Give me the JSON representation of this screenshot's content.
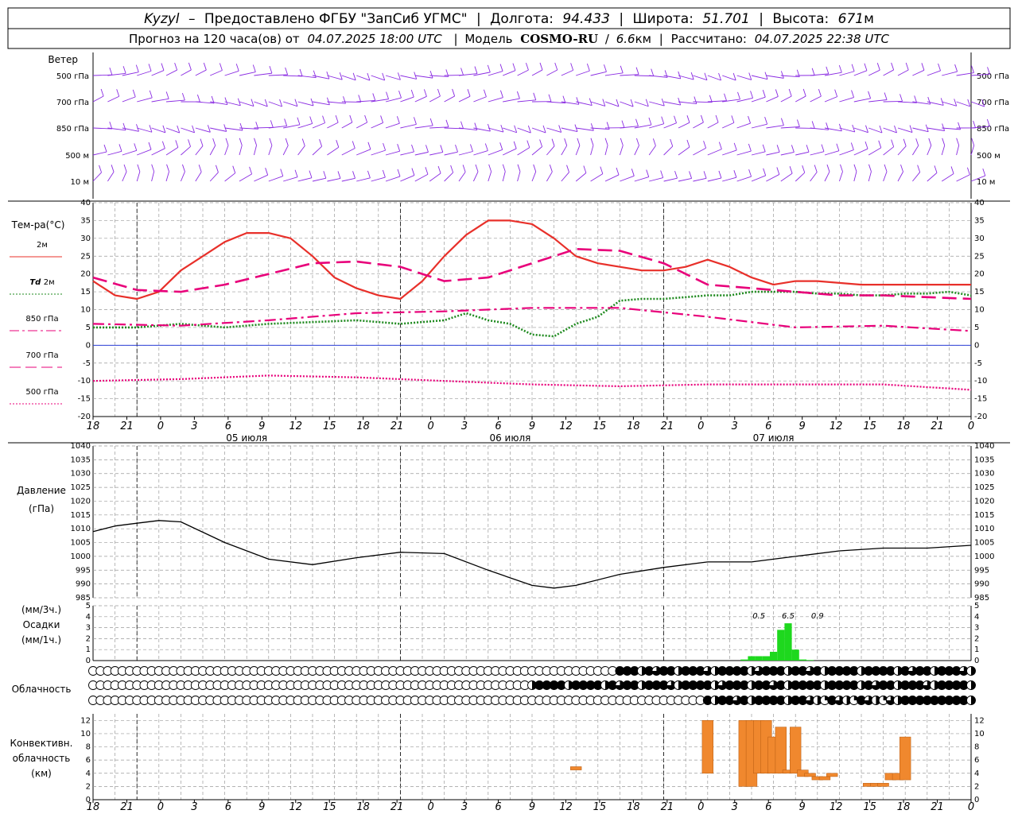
{
  "header": {
    "station": "Kyzyl",
    "dash": "–",
    "provider": "Предоставлено ФГБУ \"ЗапСиб УГМС\"",
    "lon_label": "Долгота:",
    "lon_value": "94.433",
    "lat_label": "Широта:",
    "lat_value": "51.701",
    "alt_label": "Высота:",
    "alt_value": "671",
    "alt_unit": "м",
    "sep": "|",
    "forecast_label": "Прогноз на 120 часа(ов) от",
    "forecast_from": "04.07.2025 18:00 UTC",
    "model_label": "Модель",
    "model_name": "COSMO-RU",
    "model_res": "6.6",
    "model_res_unit": "км",
    "calc_label": "Рассчитано:",
    "calc_time": "04.07.2025 22:38 UTC"
  },
  "wind_panel": {
    "title": "Ветер",
    "levels": [
      "500 гПа",
      "700 гПа",
      "850 гПа",
      "500 м",
      "10 м"
    ],
    "barb_color": "#8a2be2"
  },
  "temp_panel": {
    "title": "Тем-ра(°C)",
    "legend": [
      {
        "label": "2м",
        "color": "#e8302a",
        "style": "solid"
      },
      {
        "label_italic": "Td",
        "label": "2м",
        "color": "#1f8a1f",
        "style": "dotted"
      },
      {
        "label": "850 гПа",
        "color": "#e8007a",
        "style": "dash-dot"
      },
      {
        "label": "700 гПа",
        "color": "#e8007a",
        "style": "long-dash"
      },
      {
        "label": "500 гПа",
        "color": "#e8007a",
        "style": "dotted"
      }
    ],
    "yticks": [
      "40",
      "35",
      "30",
      "25",
      "20",
      "15",
      "10",
      "5",
      "0",
      "-5",
      "-10",
      "-15",
      "-20"
    ]
  },
  "time_axis": {
    "hour_labels": [
      "18",
      "21",
      "0",
      "3",
      "6",
      "9",
      "12",
      "15",
      "18",
      "21",
      "0",
      "3",
      "6",
      "9",
      "12",
      "15",
      "18",
      "21",
      "0",
      "3",
      "6",
      "9",
      "12",
      "15",
      "18",
      "21",
      "0"
    ],
    "day_labels": [
      "05 июля",
      "06 июля",
      "07 июля"
    ]
  },
  "pressure_panel": {
    "title_line1": "Давление",
    "title_line2": "(гПа)",
    "yticks": [
      "1040",
      "1035",
      "1030",
      "1025",
      "1020",
      "1015",
      "1010",
      "1005",
      "1000",
      "995",
      "990",
      "985"
    ]
  },
  "precip_panel": {
    "unit_top": "(мм/3ч.)",
    "title": "Осадки",
    "unit_bottom": "(мм/1ч.)",
    "yticks": [
      "5",
      "4",
      "3",
      "2",
      "1",
      "0"
    ],
    "totals": [
      "0.5",
      "6.5",
      "0.9"
    ],
    "bar_color": "#1ed81e"
  },
  "cloud_panel": {
    "title": "Облачность"
  },
  "conv_panel": {
    "title_line1": "Конвективн.",
    "title_line2": "облачность",
    "title_line3": "(км)",
    "yticks": [
      "12",
      "10",
      "8",
      "6",
      "4",
      "2",
      "0"
    ],
    "bar_color": "#f0882e"
  },
  "chart_data": [
    {
      "type": "line",
      "title": "Тем-ра(°C)",
      "x_unit": "hours since 04.07.2025 18:00 UTC",
      "ylim": [
        -20,
        40
      ],
      "series": [
        {
          "name": "2м",
          "x": [
            0,
            3,
            6,
            9,
            12,
            15,
            18,
            21,
            24,
            27,
            30,
            33,
            36,
            39,
            42,
            45,
            48,
            51,
            54,
            57,
            60,
            63,
            66,
            69,
            72,
            75,
            78,
            81,
            84,
            87,
            90,
            93,
            96,
            99,
            102,
            105,
            108,
            111,
            114,
            117,
            120
          ],
          "values": [
            18,
            14,
            13,
            15,
            21,
            25,
            29,
            31.5,
            31.5,
            30,
            25,
            19,
            16,
            14,
            13,
            18,
            25,
            31,
            35,
            35,
            34,
            30,
            25,
            23,
            22,
            21,
            21,
            22,
            24,
            22,
            19,
            17,
            18,
            18,
            17.5,
            17,
            17,
            17,
            17,
            17,
            17
          ]
        },
        {
          "name": "Td 2м",
          "x": [
            0,
            6,
            12,
            18,
            24,
            30,
            36,
            42,
            48,
            51,
            54,
            57,
            60,
            63,
            66,
            69,
            72,
            75,
            78,
            81,
            84,
            87,
            90,
            93,
            96,
            99,
            102,
            105,
            108,
            111,
            114,
            117,
            120
          ],
          "values": [
            5,
            5,
            6,
            5,
            6,
            6.5,
            7,
            6,
            7,
            9,
            7,
            6,
            3,
            2.5,
            6,
            8,
            12.5,
            13,
            13,
            13.5,
            14,
            14,
            15,
            15,
            15,
            14.5,
            14.5,
            14,
            14,
            14.5,
            14.5,
            15,
            14
          ]
        },
        {
          "name": "850 гПа",
          "x": [
            0,
            12,
            24,
            36,
            48,
            60,
            72,
            84,
            96,
            108,
            120
          ],
          "values": [
            6,
            5.5,
            7,
            9,
            9.5,
            10.5,
            10.5,
            8,
            5,
            5.5,
            4
          ]
        },
        {
          "name": "700 гПа",
          "x": [
            0,
            6,
            12,
            18,
            24,
            30,
            36,
            42,
            48,
            54,
            60,
            66,
            72,
            78,
            84,
            90,
            96,
            102,
            108,
            114,
            120
          ],
          "values": [
            19,
            15.5,
            15,
            17,
            20,
            23,
            23.5,
            22,
            18,
            19,
            23,
            27,
            26.5,
            23,
            17,
            16,
            15,
            14,
            14,
            13.5,
            13
          ]
        },
        {
          "name": "500 гПа",
          "x": [
            0,
            12,
            24,
            36,
            48,
            60,
            72,
            84,
            96,
            108,
            120
          ],
          "values": [
            -10,
            -9.5,
            -8.5,
            -9,
            -10,
            -11,
            -11.5,
            -11,
            -11,
            -11,
            -12.5
          ]
        }
      ]
    },
    {
      "type": "line",
      "title": "Давление (гПа)",
      "x_unit": "hours since 04.07.2025 18:00 UTC",
      "ylim": [
        985,
        1040
      ],
      "series": [
        {
          "name": "Давление",
          "x": [
            0,
            3,
            6,
            9,
            12,
            18,
            24,
            30,
            36,
            42,
            48,
            54,
            60,
            63,
            66,
            72,
            78,
            84,
            90,
            96,
            102,
            108,
            114,
            120
          ],
          "values": [
            1009,
            1011,
            1012,
            1013,
            1012.5,
            1005,
            999,
            997,
            999.5,
            1001.5,
            1001,
            995,
            989.5,
            988.5,
            989.5,
            993.5,
            996,
            998,
            998,
            1000,
            1002,
            1003,
            1003,
            1004
          ]
        }
      ]
    },
    {
      "type": "bar",
      "title": "Осадки (мм/1ч.)",
      "x_unit": "hours since 04.07.2025 18:00 UTC",
      "ylim": [
        0,
        5
      ],
      "x": [
        89,
        90,
        91,
        92,
        93,
        94,
        95,
        96,
        97,
        98
      ],
      "values": [
        0.1,
        0.4,
        0.4,
        0.4,
        0.8,
        2.8,
        3.4,
        1.0,
        0.1,
        0.05
      ]
    },
    {
      "type": "bar",
      "title": "Конвективн. облачность (км)",
      "x_unit": "hours since 04.07.2025 18:00 UTC",
      "ylim": [
        0,
        12
      ],
      "bars": [
        {
          "x": 66,
          "bottom": 4.5,
          "top": 5
        },
        {
          "x": 84,
          "bottom": 4,
          "top": 12
        },
        {
          "x": 89,
          "bottom": 2,
          "top": 12
        },
        {
          "x": 90,
          "bottom": 2,
          "top": 12
        },
        {
          "x": 91,
          "bottom": 4,
          "top": 12
        },
        {
          "x": 92,
          "bottom": 4,
          "top": 12
        },
        {
          "x": 93,
          "bottom": 4,
          "top": 9.5
        },
        {
          "x": 94,
          "bottom": 4,
          "top": 11
        },
        {
          "x": 95,
          "bottom": 4,
          "top": 4.5
        },
        {
          "x": 96,
          "bottom": 4,
          "top": 11
        },
        {
          "x": 97,
          "bottom": 3.5,
          "top": 4.5
        },
        {
          "x": 98,
          "bottom": 3.5,
          "top": 4
        },
        {
          "x": 99,
          "bottom": 3,
          "top": 3.5
        },
        {
          "x": 100,
          "bottom": 3,
          "top": 3.5
        },
        {
          "x": 101,
          "bottom": 3.5,
          "top": 4
        },
        {
          "x": 106,
          "bottom": 2,
          "top": 2.5
        },
        {
          "x": 107,
          "bottom": 2,
          "top": 2.5
        },
        {
          "x": 108,
          "bottom": 2,
          "top": 2.5
        },
        {
          "x": 109,
          "bottom": 3,
          "top": 4
        },
        {
          "x": 110,
          "bottom": 3,
          "top": 4
        },
        {
          "x": 111,
          "bottom": 3,
          "top": 9.5
        }
      ]
    }
  ]
}
